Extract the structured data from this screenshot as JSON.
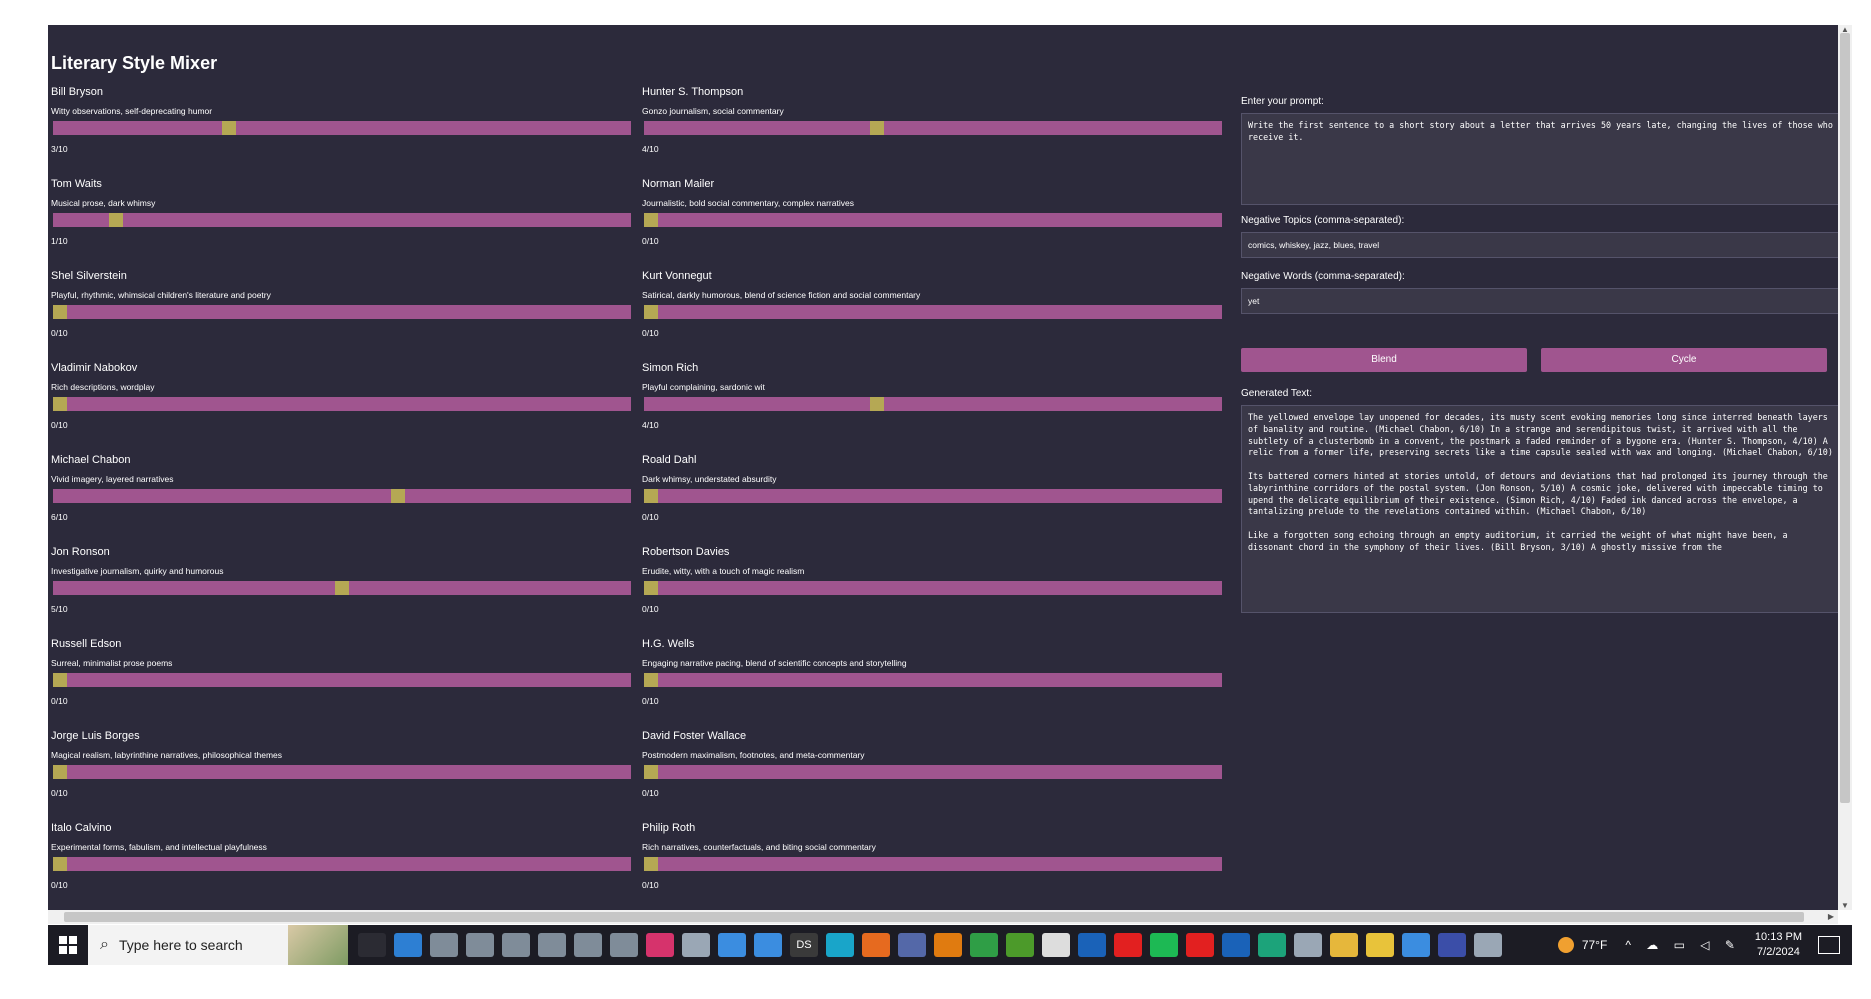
{
  "app": {
    "title": "Literary Style Mixer"
  },
  "authors": [
    {
      "name": "Bill Bryson",
      "desc": "Witty observations, self-deprecating humor",
      "value": 3,
      "max": 10,
      "label": "3/10"
    },
    {
      "name": "Hunter S. Thompson",
      "desc": "Gonzo journalism, social commentary",
      "value": 4,
      "max": 10,
      "label": "4/10"
    },
    {
      "name": "Tom Waits",
      "desc": "Musical prose, dark whimsy",
      "value": 1,
      "max": 10,
      "label": "1/10"
    },
    {
      "name": "Norman Mailer",
      "desc": "Journalistic, bold social commentary, complex narratives",
      "value": 0,
      "max": 10,
      "label": "0/10"
    },
    {
      "name": "Shel Silverstein",
      "desc": "Playful, rhythmic, whimsical children's literature and poetry",
      "value": 0,
      "max": 10,
      "label": "0/10"
    },
    {
      "name": "Kurt Vonnegut",
      "desc": "Satirical, darkly humorous, blend of science fiction and social commentary",
      "value": 0,
      "max": 10,
      "label": "0/10"
    },
    {
      "name": "Vladimir Nabokov",
      "desc": "Rich descriptions, wordplay",
      "value": 0,
      "max": 10,
      "label": "0/10"
    },
    {
      "name": "Simon Rich",
      "desc": "Playful complaining, sardonic wit",
      "value": 4,
      "max": 10,
      "label": "4/10"
    },
    {
      "name": "Michael Chabon",
      "desc": "Vivid imagery, layered narratives",
      "value": 6,
      "max": 10,
      "label": "6/10"
    },
    {
      "name": "Roald Dahl",
      "desc": "Dark whimsy, understated absurdity",
      "value": 0,
      "max": 10,
      "label": "0/10"
    },
    {
      "name": "Jon Ronson",
      "desc": "Investigative journalism, quirky and humorous",
      "value": 5,
      "max": 10,
      "label": "5/10"
    },
    {
      "name": "Robertson Davies",
      "desc": "Erudite, witty, with a touch of magic realism",
      "value": 0,
      "max": 10,
      "label": "0/10"
    },
    {
      "name": "Russell Edson",
      "desc": "Surreal, minimalist prose poems",
      "value": 0,
      "max": 10,
      "label": "0/10"
    },
    {
      "name": "H.G. Wells",
      "desc": "Engaging narrative pacing, blend of scientific concepts and storytelling",
      "value": 0,
      "max": 10,
      "label": "0/10"
    },
    {
      "name": "Jorge Luis Borges",
      "desc": "Magical realism, labyrinthine narratives, philosophical themes",
      "value": 0,
      "max": 10,
      "label": "0/10"
    },
    {
      "name": "David Foster Wallace",
      "desc": "Postmodern maximalism, footnotes, and meta-commentary",
      "value": 0,
      "max": 10,
      "label": "0/10"
    },
    {
      "name": "Italo Calvino",
      "desc": "Experimental forms, fabulism, and intellectual playfulness",
      "value": 0,
      "max": 10,
      "label": "0/10"
    },
    {
      "name": "Philip Roth",
      "desc": "Rich narratives, counterfactuals, and biting social commentary",
      "value": 0,
      "max": 10,
      "label": "0/10"
    }
  ],
  "colors": {
    "background": "#2c2a3b",
    "track": "#a0558f",
    "thumb": "#b5a854",
    "button": "#a0558f"
  },
  "prompt": {
    "label": "Enter your prompt:",
    "value": "Write the first sentence to a short story about a letter that arrives 50 years late, changing the lives of those who receive it."
  },
  "negative_topics": {
    "label": "Negative Topics (comma-separated):",
    "value": "comics, whiskey, jazz, blues, travel"
  },
  "negative_words": {
    "label": "Negative Words (comma-separated):",
    "value": "yet"
  },
  "buttons": {
    "blend": "Blend",
    "cycle": "Cycle"
  },
  "generated": {
    "label": "Generated Text:",
    "value": "The yellowed envelope lay unopened for decades, its musty scent evoking memories long since interred beneath layers of banality and routine. (Michael Chabon, 6/10) In a strange and serendipitous twist, it arrived with all the subtlety of a clusterbomb in a convent, the postmark a faded reminder of a bygone era. (Hunter S. Thompson, 4/10) A relic from a former life, preserving secrets like a time capsule sealed with wax and longing. (Michael Chabon, 6/10)\n\nIts battered corners hinted at stories untold, of detours and deviations that had prolonged its journey through the labyrinthine corridors of the postal system. (Jon Ronson, 5/10) A cosmic joke, delivered with impeccable timing to upend the delicate equilibrium of their existence. (Simon Rich, 4/10) Faded ink danced across the envelope, a tantalizing prelude to the revelations contained within. (Michael Chabon, 6/10)\n\nLike a forgotten song echoing through an empty auditorium, it carried the weight of what might have been, a dissonant chord in the symphony of their lives. (Bill Bryson, 3/10) A ghostly missive from the"
  },
  "taskbar": {
    "search_placeholder": "Type here to search",
    "dock_badge": "DS",
    "weather": "77°F",
    "time": "10:13 PM",
    "date": "7/2/2024",
    "apps": [
      {
        "name": "task-view-icon",
        "color": "#2b2b33"
      },
      {
        "name": "mail-icon",
        "color": "#2d7fd3"
      },
      {
        "name": "file-icon",
        "color": "#7f8c99"
      },
      {
        "name": "file-icon",
        "color": "#7f8c99"
      },
      {
        "name": "file-icon",
        "color": "#7f8c99"
      },
      {
        "name": "file-icon",
        "color": "#7f8c99"
      },
      {
        "name": "file-icon",
        "color": "#7f8c99"
      },
      {
        "name": "file-icon",
        "color": "#7f8c99"
      },
      {
        "name": "instagram-icon",
        "color": "#d6336c"
      },
      {
        "name": "app-icon",
        "color": "#9aa7b5"
      },
      {
        "name": "cloud-icon",
        "color": "#3b8de0"
      },
      {
        "name": "cloud-icon",
        "color": "#3b8de0"
      },
      {
        "name": "ds-icon",
        "color": "#3a3a3a"
      },
      {
        "name": "window-icon",
        "color": "#19a5c9"
      },
      {
        "name": "firefox-icon",
        "color": "#e66a1f"
      },
      {
        "name": "browser-icon",
        "color": "#5468a8"
      },
      {
        "name": "search-app-icon",
        "color": "#e07b10"
      },
      {
        "name": "chrome-icon",
        "color": "#2f9e46"
      },
      {
        "name": "game-icon",
        "color": "#4c9a2a"
      },
      {
        "name": "inkscape-icon",
        "color": "#dddddd"
      },
      {
        "name": "outlook-icon",
        "color": "#1a62b8"
      },
      {
        "name": "youtube-icon",
        "color": "#e22020"
      },
      {
        "name": "spotify-icon",
        "color": "#1db954"
      },
      {
        "name": "youtube-icon",
        "color": "#e22020"
      },
      {
        "name": "outlook-icon",
        "color": "#1a62b8"
      },
      {
        "name": "edge-icon",
        "color": "#1ca37a"
      },
      {
        "name": "app-icon",
        "color": "#9aa7b5"
      },
      {
        "name": "folder-icon",
        "color": "#e6b73b"
      },
      {
        "name": "note-icon",
        "color": "#e8c33a"
      },
      {
        "name": "app-icon",
        "color": "#3b8de0"
      },
      {
        "name": "premiere-icon",
        "color": "#3b4ea8"
      },
      {
        "name": "app-icon",
        "color": "#9aa7b5"
      }
    ]
  }
}
